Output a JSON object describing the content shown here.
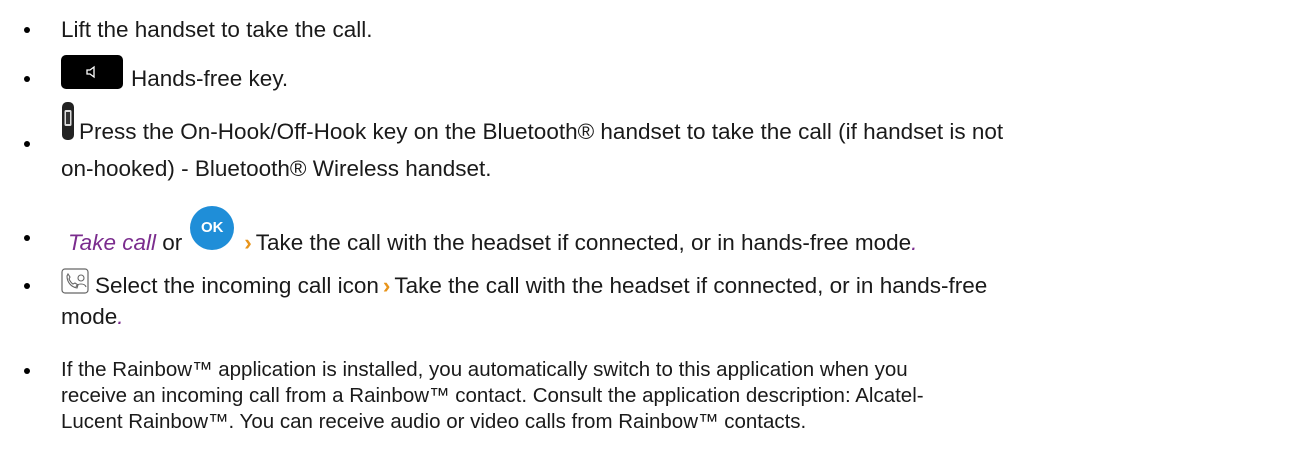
{
  "items": [
    {
      "text": "Lift the handset to take the call."
    },
    {
      "text": "Hands-free key.",
      "icon": "speaker-key-icon"
    },
    {
      "text_line1": "Press the On-Hook/Off-Hook key on the Bluetooth® handset to take the call (if handset is not",
      "text_line2": "on-hooked) - Bluetooth® Wireless handset.",
      "icon": "bluetooth-handset-icon"
    },
    {
      "link": "Take call",
      "or": "or",
      "ok_label": "OK",
      "text": "Take the call with the headset if connected, or in hands-free mode",
      "end": ".",
      "icon": "ok-button-icon"
    },
    {
      "text_line1": "Select the incoming call icon",
      "text_line1b": "Take the call with the headset if connected, or in hands-free",
      "text_line2": "mode",
      "end": ".",
      "icon": "incoming-call-icon"
    },
    {
      "text_line1": "If the Rainbow™ application is installed, you automatically switch to this application when you",
      "text_line2": "receive an incoming call from a Rainbow™ contact. Consult the application description: Alcatel-",
      "text_line3": "Lucent Rainbow™. You can receive audio or video calls from Rainbow™ contacts."
    }
  ],
  "arrow_glyph": "›",
  "colors": {
    "accent_orange": "#e8941a",
    "ok_blue": "#1f8ed8",
    "link_purple": "#7b2d8e"
  }
}
